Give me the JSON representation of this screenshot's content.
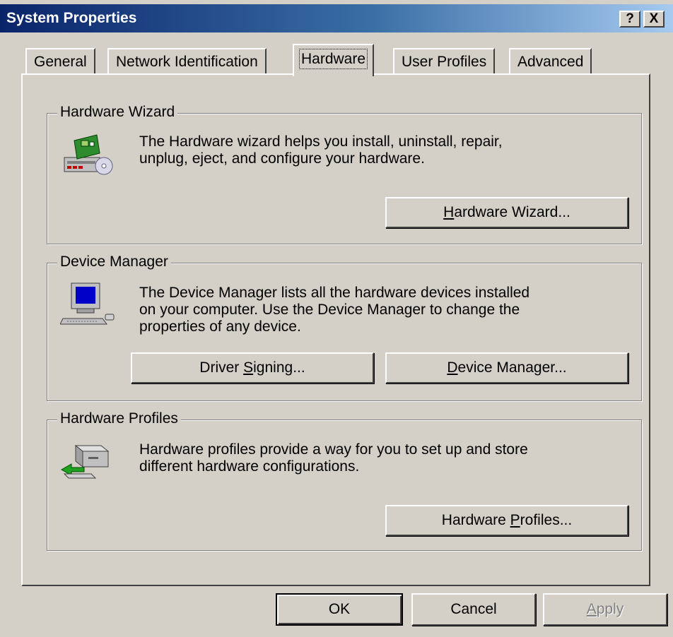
{
  "window": {
    "title": "System Properties",
    "help_btn": "?",
    "close_btn": "X"
  },
  "tabs": [
    {
      "label": "General",
      "active": false
    },
    {
      "label": "Network Identification",
      "active": false
    },
    {
      "label": "Hardware",
      "active": true
    },
    {
      "label": "User Profiles",
      "active": false
    },
    {
      "label": "Advanced",
      "active": false
    }
  ],
  "hardware_wizard": {
    "title": "Hardware Wizard",
    "desc_line1": "The Hardware wizard helps you install, uninstall, repair,",
    "desc_line2": "unplug, eject, and configure your hardware.",
    "button": {
      "accel": "H",
      "rest": "ardware Wizard..."
    },
    "icon": "hardware-wizard-icon"
  },
  "device_manager": {
    "title": "Device Manager",
    "desc_line1": "The Device Manager lists all the hardware devices installed",
    "desc_line2": "on your computer. Use the Device Manager to change the",
    "desc_line3": "properties of any device.",
    "driver_button": {
      "pre": "Driver ",
      "accel": "S",
      "rest": "igning..."
    },
    "manager_button": {
      "accel": "D",
      "rest": "evice Manager..."
    },
    "icon": "computer-icon"
  },
  "hardware_profiles": {
    "title": "Hardware Profiles",
    "desc_line1": "Hardware profiles provide a way for you to set up and store",
    "desc_line2": "different hardware configurations.",
    "button": {
      "pre": "Hardware ",
      "accel": "P",
      "rest": "rofiles..."
    },
    "icon": "hardware-profiles-icon"
  },
  "footer": {
    "ok": "OK",
    "cancel": "Cancel",
    "apply": {
      "accel": "A",
      "rest": "pply",
      "enabled": false
    }
  },
  "colors": {
    "face": "#d4d0c8",
    "title_start": "#0a246a",
    "title_end": "#a6caf0"
  }
}
